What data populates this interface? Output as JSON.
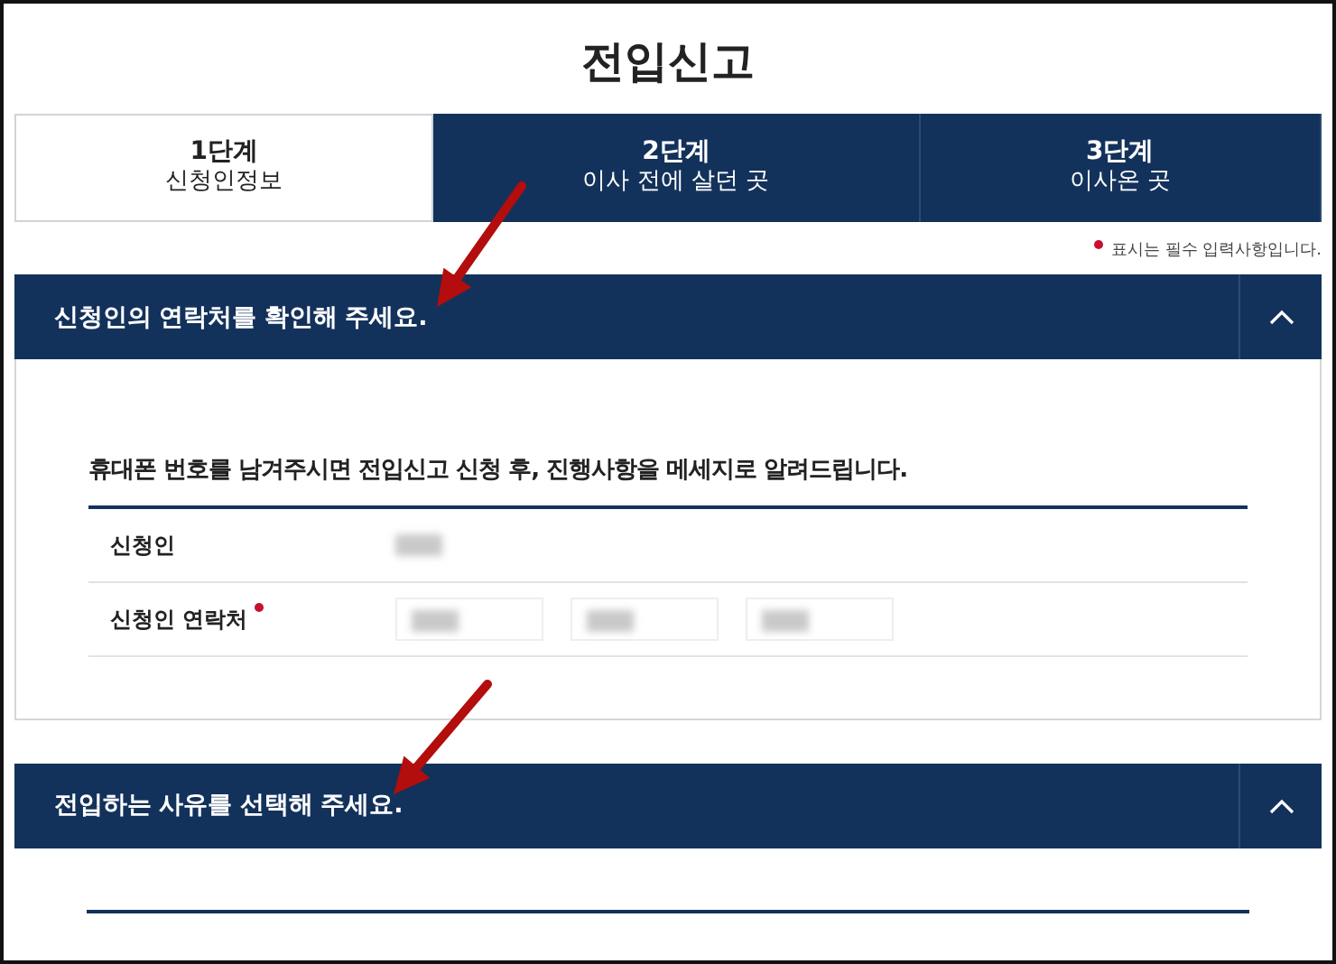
{
  "page_title": "전입신고",
  "steps": [
    {
      "number": "1단계",
      "label": "신청인정보",
      "selected": true
    },
    {
      "number": "2단계",
      "label": "이사 전에 살던 곳",
      "selected": false
    },
    {
      "number": "3단계",
      "label": "이사온 곳",
      "selected": false
    }
  ],
  "required_note": "표시는 필수 입력사항입니다.",
  "sections": [
    {
      "title": "신청인의 연락처를 확인해 주세요.",
      "expanded": true,
      "intro": "휴대폰 번호를 남겨주시면 전입신고 신청 후, 진행사항을 메세지로 알려드립니다.",
      "rows": [
        {
          "label": "신청인",
          "required": false,
          "kind": "text"
        },
        {
          "label": "신청인 연락처",
          "required": true,
          "kind": "phone"
        }
      ]
    },
    {
      "title": "전입하는 사유를 선택해 주세요.",
      "expanded": true
    }
  ]
}
